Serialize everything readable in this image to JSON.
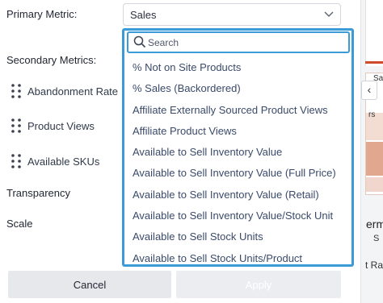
{
  "labels": {
    "primary_metric": "Primary Metric:",
    "secondary_metrics": "Secondary Metrics:",
    "transparency": "Transparency",
    "scale": "Scale"
  },
  "primary_select": {
    "value": "Sales",
    "icon": "chevron-down-icon"
  },
  "secondary_metrics": [
    {
      "label": "Abandonment Rate",
      "icon": "drag-handle-icon"
    },
    {
      "label": "Product Views",
      "icon": "drag-handle-icon"
    },
    {
      "label": "Available SKUs",
      "icon": "drag-handle-icon"
    }
  ],
  "dropdown": {
    "search_placeholder": "Search",
    "search_icon": "search-icon",
    "options": [
      "% Not on Site Products",
      "% Sales (Backordered)",
      "Affiliate Externally Sourced Product Views",
      "Affiliate Product Views",
      "Available to Sell Inventory Value",
      "Available to Sell Inventory Value (Full Price)",
      "Available to Sell Inventory Value (Retail)",
      "Available to Sell Inventory Value/Stock Unit",
      "Available to Sell Stock Units",
      "Available to Sell Stock Units/Product"
    ]
  },
  "buttons": {
    "cancel": "Cancel",
    "apply": "Apply"
  },
  "background": {
    "collapse_glyph": "‹",
    "text_sa": "Sa",
    "text_rs": "rs",
    "text_erm": "erm",
    "text_s": "S",
    "text_ra": "t Ra"
  },
  "colors": {
    "accent": "#3a9bd6",
    "apply_disabled": "#ecedf0",
    "cancel_bg": "#e7e8ec"
  }
}
